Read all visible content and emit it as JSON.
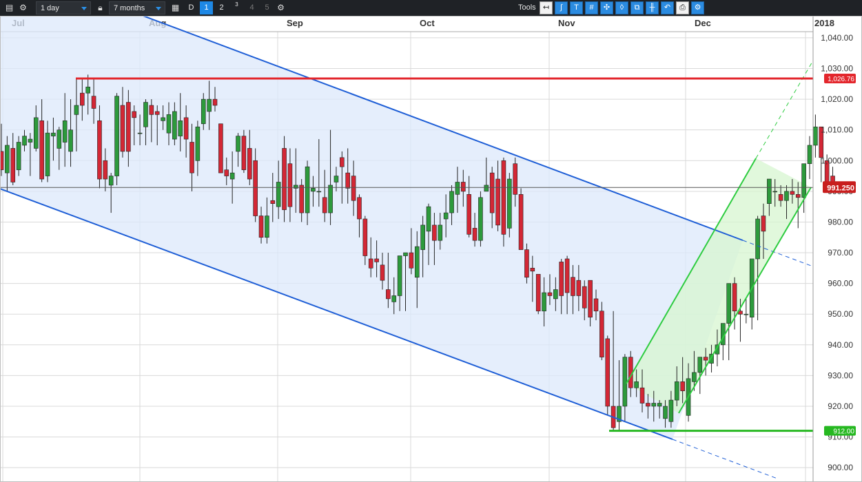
{
  "toolbar": {
    "interval": "1 day",
    "range": "7 months",
    "d_label": "D",
    "chart_counts": [
      "1",
      "2",
      "3",
      "4",
      "5"
    ],
    "tools_label": "Tools",
    "icons": [
      "data-grid-icon",
      "settings-icon",
      "lock-icon",
      "calendar-icon",
      "chart-settings-icon",
      "back-arrow-icon",
      "curve-tool-icon",
      "text-tool-icon",
      "grid-tool-icon",
      "crosshair-tool-icon",
      "candle-tool-icon",
      "multi-chart-icon",
      "bars-tool-icon",
      "undo-icon",
      "print-icon",
      "tools-settings-icon"
    ]
  },
  "chart_data": {
    "type": "candlestick",
    "x_labels": [
      "Jul",
      "Aug",
      "Sep",
      "Oct",
      "Nov",
      "Dec",
      "2018"
    ],
    "y_ticks": [
      900,
      910,
      920,
      930,
      940,
      950,
      960,
      970,
      980,
      990,
      1000,
      1010,
      1020,
      1030,
      1040
    ],
    "y_tick_labels": [
      "900.00",
      "910.00",
      "920.00",
      "930.00",
      "940.00",
      "950.00",
      "960.00",
      "970.00",
      "980.00",
      "990.00",
      "1,000.00",
      "1,010.00",
      "1,020.00",
      "1,030.00",
      "1,040.00"
    ],
    "ylim": [
      896,
      1043
    ],
    "grid": true,
    "colors": {
      "up": "#2d9a3c",
      "down": "#d32735",
      "channel_down": "#1e5ed6",
      "channel_up": "#2ecc40",
      "resistance": "#e3262c",
      "support": "#26b821",
      "price_marker": "#c81e1e"
    },
    "candles": [
      [
        1003,
        1012,
        995,
        997
      ],
      [
        996,
        1008,
        990,
        1005
      ],
      [
        1004,
        1009,
        992,
        993
      ],
      [
        997,
        1008,
        995,
        1006
      ],
      [
        1005,
        1010,
        1003,
        1008
      ],
      [
        1006,
        1009,
        995,
        1007
      ],
      [
        1004,
        1018,
        1003,
        1014
      ],
      [
        1013,
        1020,
        993,
        994
      ],
      [
        995,
        1013,
        993,
        1009
      ],
      [
        1008,
        1014,
        1000,
        1009
      ],
      [
        1004,
        1011,
        997,
        1010
      ],
      [
        1006,
        1022,
        998,
        1013
      ],
      [
        1003,
        1020,
        998,
        1010
      ],
      [
        1015,
        1027,
        1003,
        1018
      ],
      [
        1022,
        1027,
        1013,
        1018
      ],
      [
        1022,
        1028,
        1015,
        1024
      ],
      [
        1021,
        1027,
        1012,
        1017
      ],
      [
        1013,
        1018,
        991,
        994
      ],
      [
        1000,
        1004,
        990,
        994
      ],
      [
        992,
        996,
        983,
        995
      ],
      [
        995,
        1022,
        992,
        1021
      ],
      [
        1018,
        1024,
        1001,
        1003
      ],
      [
        1019,
        1023,
        998,
        1003
      ],
      [
        1016,
        1018,
        1005,
        1014
      ],
      [
        1009,
        1015,
        1005,
        1009
      ],
      [
        1011,
        1020,
        1005,
        1019
      ],
      [
        1018,
        1020,
        1006,
        1015
      ],
      [
        1016,
        1018,
        1005,
        1015
      ],
      [
        1013,
        1018,
        1010,
        1014
      ],
      [
        1009,
        1019,
        1005,
        1015
      ],
      [
        1007,
        1019,
        1005,
        1016
      ],
      [
        1008,
        1022,
        1003,
        1013
      ],
      [
        1014,
        1018,
        1001,
        1007
      ],
      [
        1006,
        1012,
        990,
        996
      ],
      [
        1000,
        1013,
        995,
        1011
      ],
      [
        1012,
        1022,
        1010,
        1020
      ],
      [
        1016,
        1026,
        1010,
        1020
      ],
      [
        1020,
        1024,
        1016,
        1018
      ],
      [
        1012,
        1012,
        997,
        996
      ],
      [
        997,
        1001,
        992,
        995
      ],
      [
        994,
        1003,
        986,
        996
      ],
      [
        1003,
        1009,
        998,
        1008
      ],
      [
        1008,
        1010,
        996,
        997
      ],
      [
        1004,
        1010,
        992,
        994
      ],
      [
        1000,
        1004,
        980,
        982
      ],
      [
        982,
        985,
        973,
        975
      ],
      [
        975,
        988,
        973,
        982
      ],
      [
        987,
        996,
        980,
        986
      ],
      [
        985,
        1000,
        981,
        993
      ],
      [
        1004,
        1008,
        980,
        984
      ],
      [
        999,
        1004,
        980,
        985
      ],
      [
        991,
        1004,
        983,
        992
      ],
      [
        992,
        994,
        980,
        983
      ],
      [
        983,
        1000,
        979,
        998
      ],
      [
        990,
        995,
        985,
        991
      ],
      [
        990,
        1007,
        985,
        990
      ],
      [
        988,
        997,
        980,
        983
      ],
      [
        983,
        1010,
        979,
        992
      ],
      [
        993,
        998,
        990,
        995
      ],
      [
        1001,
        1003,
        986,
        998
      ],
      [
        996,
        1004,
        986,
        991
      ],
      [
        995,
        1000,
        982,
        987
      ],
      [
        988,
        989,
        975,
        981
      ],
      [
        981,
        982,
        966,
        969
      ],
      [
        968,
        975,
        962,
        965
      ],
      [
        968,
        974,
        962,
        967
      ],
      [
        966,
        970,
        958,
        961
      ],
      [
        958,
        970,
        952,
        955
      ],
      [
        954,
        962,
        950,
        956
      ],
      [
        956,
        969,
        951,
        969
      ],
      [
        969,
        970,
        951,
        970
      ],
      [
        970,
        978,
        963,
        965
      ],
      [
        962,
        977,
        952,
        972
      ],
      [
        971,
        982,
        962,
        979
      ],
      [
        977,
        986,
        966,
        985
      ],
      [
        979,
        983,
        966,
        974
      ],
      [
        974,
        983,
        971,
        979
      ],
      [
        981,
        989,
        975,
        983
      ],
      [
        983,
        992,
        979,
        990
      ],
      [
        989,
        998,
        983,
        993
      ],
      [
        993,
        997,
        985,
        990
      ],
      [
        989,
        995,
        975,
        976
      ],
      [
        978,
        983,
        972,
        974
      ],
      [
        974,
        990,
        972,
        988
      ],
      [
        990,
        1001,
        990,
        992
      ],
      [
        996,
        998,
        978,
        983
      ],
      [
        994,
        1000,
        977,
        979
      ],
      [
        1000,
        1001,
        972,
        976
      ],
      [
        978,
        996,
        975,
        994
      ],
      [
        999,
        1001,
        985,
        989
      ],
      [
        989,
        991,
        984,
        971
      ],
      [
        971,
        973,
        960,
        962
      ],
      [
        965,
        969,
        954,
        964
      ],
      [
        963,
        963,
        950,
        951
      ],
      [
        951,
        962,
        946,
        957
      ],
      [
        957,
        963,
        953,
        956
      ],
      [
        955,
        962,
        951,
        958
      ],
      [
        967,
        968,
        950,
        956
      ],
      [
        968,
        969,
        950,
        957
      ],
      [
        962,
        966,
        950,
        956
      ],
      [
        961,
        966,
        951,
        956
      ],
      [
        959,
        961,
        948,
        952
      ],
      [
        961,
        961,
        946,
        949
      ],
      [
        955,
        958,
        948,
        951
      ],
      [
        951,
        954,
        935,
        936
      ],
      [
        942,
        943,
        917,
        920
      ],
      [
        920,
        951,
        912,
        913
      ],
      [
        915,
        935,
        912,
        920
      ],
      [
        920,
        937,
        915,
        936
      ],
      [
        936,
        938,
        923,
        926
      ],
      [
        926,
        932,
        923,
        928
      ],
      [
        926,
        932,
        918,
        921
      ],
      [
        921,
        924,
        916,
        920
      ],
      [
        920,
        925,
        915,
        921
      ],
      [
        920,
        922,
        916,
        921
      ],
      [
        916,
        922,
        913,
        920
      ],
      [
        915,
        925,
        913,
        922
      ],
      [
        922,
        933,
        920,
        928
      ],
      [
        928,
        936,
        921,
        925
      ],
      [
        917,
        934,
        915,
        929
      ],
      [
        928,
        938,
        925,
        931
      ],
      [
        931,
        936,
        924,
        936
      ],
      [
        936,
        939,
        930,
        935
      ],
      [
        934,
        940,
        931,
        937
      ],
      [
        937,
        945,
        933,
        940
      ],
      [
        940,
        943,
        935,
        947
      ],
      [
        947,
        955,
        935,
        960
      ],
      [
        960,
        962,
        945,
        951
      ],
      [
        951,
        955,
        941,
        950
      ],
      [
        950,
        955,
        947,
        950
      ],
      [
        949,
        955,
        945,
        968
      ],
      [
        968,
        982,
        948,
        981
      ],
      [
        982,
        986,
        968,
        977
      ],
      [
        986,
        994,
        982,
        994
      ],
      [
        990,
        994,
        985,
        990
      ],
      [
        989,
        992,
        985,
        987
      ],
      [
        987,
        992,
        981,
        990
      ],
      [
        990,
        994,
        986,
        989
      ],
      [
        989,
        993,
        978,
        988
      ],
      [
        988,
        997,
        983,
        999
      ],
      [
        999,
        1008,
        994,
        1005
      ],
      [
        1005,
        1015,
        1001,
        1011
      ],
      [
        1011,
        1011,
        993,
        1001
      ],
      [
        1000,
        1002,
        990,
        991
      ],
      [
        995,
        998,
        990,
        991.25
      ]
    ],
    "resistance": 1026.76,
    "resistance_label": "1,026.76",
    "support": 912.0,
    "support_label": "912.00",
    "last_price": 991.25,
    "last_price_label": "991.250"
  }
}
